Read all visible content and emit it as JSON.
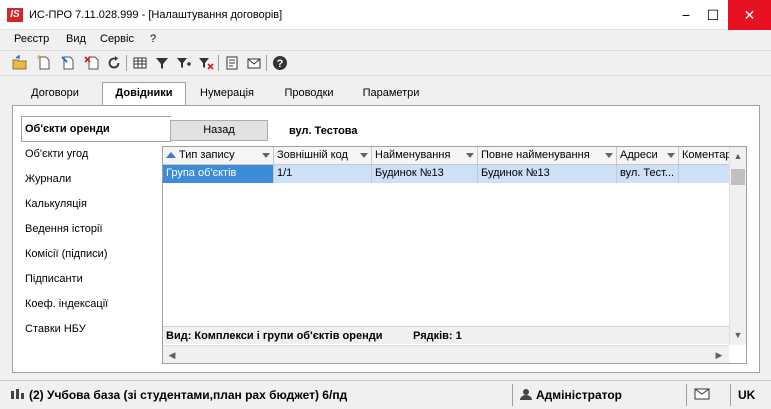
{
  "window": {
    "logo": "IS",
    "title": "ИС-ПРО 7.11.028.999 - [Налаштування договорів]",
    "minimize": "−",
    "maximize": "☐",
    "close": "✕"
  },
  "menu": [
    "Реєстр",
    "Вид",
    "Сервіс",
    "?"
  ],
  "toolbar": {
    "icons": [
      "open-folder-icon",
      "new-document-icon",
      "edit-document-icon",
      "delete-document-icon",
      "refresh-icon",
      "table-icon",
      "filter-icon",
      "filter-settings-icon",
      "clear-filter-icon",
      "document-icon",
      "mail-icon",
      "help-icon"
    ]
  },
  "tabs": [
    {
      "label": "Договори",
      "active": false
    },
    {
      "label": "Довідники",
      "active": true
    },
    {
      "label": "Нумерація",
      "active": false
    },
    {
      "label": "Проводки",
      "active": false
    },
    {
      "label": "Параметри",
      "active": false
    }
  ],
  "nav": [
    {
      "label": "Об'єкти оренди",
      "active": true
    },
    {
      "label": "Об'єкти угод",
      "active": false
    },
    {
      "label": "Журнали",
      "active": false
    },
    {
      "label": "Калькуляція",
      "active": false
    },
    {
      "label": "Ведення історії",
      "active": false
    },
    {
      "label": "Комісії (підписи)",
      "active": false
    },
    {
      "label": "Підписанти",
      "active": false
    },
    {
      "label": "Коеф. індексації",
      "active": false
    },
    {
      "label": "Ставки НБУ",
      "active": false
    }
  ],
  "back_button": "Назад",
  "address_label": "вул. Тестова",
  "grid": {
    "columns": [
      "Тип запису",
      "Зовнішній код",
      "Найменування",
      "Повне найменування",
      "Адреси",
      "Коментар"
    ],
    "rows": [
      [
        "Група об'єктів",
        "1/1",
        "Будинок №13",
        "Будинок №13",
        "вул. Тест...",
        ""
      ]
    ]
  },
  "footer": {
    "view": "Вид: Комплекси і групи об'єктів оренди",
    "rows": "Рядків: 1"
  },
  "status": {
    "database": "(2) Учбова база (зі студентами,план рах бюджет) 6/пд",
    "user": "Адміністратор",
    "lang": "UK"
  },
  "colors": {
    "accent": "#3c8cd8",
    "selection": "#cce0f8",
    "close": "#e81123",
    "logo": "#d6262b"
  }
}
